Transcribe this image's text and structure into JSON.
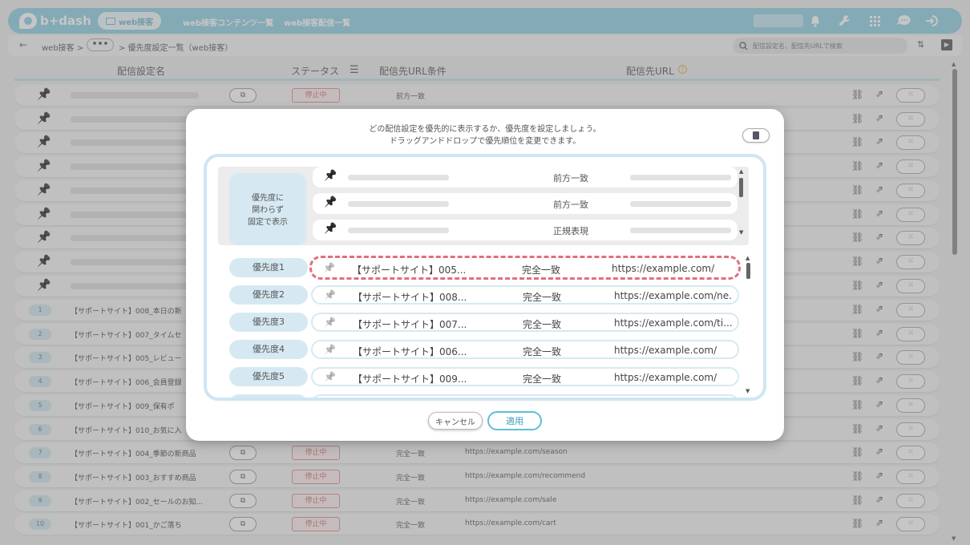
{
  "header": {
    "logo_text": "b+dash",
    "nav_active": "web接客",
    "nav_links": [
      "web接客コンテンツ一覧",
      "web接客配信一覧"
    ],
    "icons": [
      "bell-icon",
      "wrench-icon",
      "grid-icon",
      "chat-icon",
      "logout-icon"
    ]
  },
  "breadcrumb": {
    "items": [
      "web接客 >",
      "•••",
      "> 優先度設定一覧（web接客）"
    ]
  },
  "search": {
    "placeholder": "配信設定名、配信先URLで検索"
  },
  "list": {
    "columns": [
      "配信設定名",
      "ステータス",
      "配信先URL条件",
      "配信先URL"
    ],
    "status_label": "停止中",
    "fixed_condition": "前方一致",
    "numbered_rows": [
      {
        "num": "1",
        "name": "【サポートサイト】008_本日の新",
        "cond": "",
        "url": ""
      },
      {
        "num": "2",
        "name": "【サポートサイト】007_タイムセ",
        "cond": "",
        "url": ""
      },
      {
        "num": "3",
        "name": "【サポートサイト】005_レビュー",
        "cond": "",
        "url": ""
      },
      {
        "num": "4",
        "name": "【サポートサイト】006_会員登録",
        "cond": "",
        "url": ""
      },
      {
        "num": "5",
        "name": "【サポートサイト】009_保有ポ",
        "cond": "",
        "url": ""
      },
      {
        "num": "6",
        "name": "【サポートサイト】010_お気に入",
        "cond": "",
        "url": ""
      },
      {
        "num": "7",
        "name": "【サポートサイト】004_季節の新商品",
        "cond": "完全一致",
        "url": "https://example.com/season"
      },
      {
        "num": "8",
        "name": "【サポートサイト】003_おすすめ商品",
        "cond": "完全一致",
        "url": "https://example.com/recommend"
      },
      {
        "num": "9",
        "name": "【サポートサイト】002_セールのお知...",
        "cond": "完全一致",
        "url": "https://example.com/sale"
      },
      {
        "num": "10",
        "name": "【サポートサイト】001_かご落ち",
        "cond": "完全一致",
        "url": "https://example.com/cart"
      }
    ]
  },
  "modal": {
    "description_line1": "どの配信設定を優先的に表示するか、優先度を設定しましょう。",
    "description_line2": "ドラッグアンドドロップで優先順位を変更できます。",
    "fixed_label": "優先度に\n関わらず\n固定で表示",
    "fixed_rows": [
      {
        "match": "前方一致"
      },
      {
        "match": "前方一致"
      },
      {
        "match": "正規表現"
      }
    ],
    "priority_rows": [
      {
        "label": "優先度1",
        "name": "【サポートサイト】005...",
        "match": "完全一致",
        "url": "https://example.com/"
      },
      {
        "label": "優先度2",
        "name": "【サポートサイト】008...",
        "match": "完全一致",
        "url": "https://example.com/ne..."
      },
      {
        "label": "優先度3",
        "name": "【サポートサイト】007...",
        "match": "完全一致",
        "url": "https://example.com/ti..."
      },
      {
        "label": "優先度4",
        "name": "【サポートサイト】006...",
        "match": "完全一致",
        "url": "https://example.com/"
      },
      {
        "label": "優先度5",
        "name": "【サポートサイト】009...",
        "match": "完全一致",
        "url": "https://example.com/"
      }
    ],
    "cancel_label": "キャンセル",
    "apply_label": "適用"
  },
  "colors": {
    "header_bg": "#8ecfe4",
    "accent": "#5fbdd8",
    "selected_dash": "#e26f7b",
    "status_red": "#d26b6b"
  }
}
